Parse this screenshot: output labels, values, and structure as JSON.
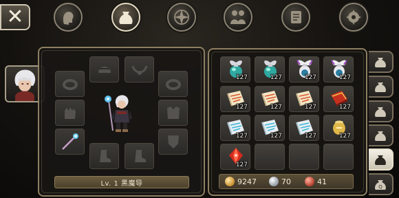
{
  "top_bar": {
    "close_label": "✕",
    "tabs": [
      {
        "name": "character",
        "icon": "head-silhouette-icon"
      },
      {
        "name": "inventory",
        "icon": "bag-icon",
        "active": true
      },
      {
        "name": "skills",
        "icon": "compass-star-icon"
      },
      {
        "name": "party",
        "icon": "two-people-icon"
      },
      {
        "name": "quests",
        "icon": "scroll-icon"
      },
      {
        "name": "settings",
        "icon": "gear-icon"
      }
    ]
  },
  "equipment": {
    "level_label": "Lv. 1 黑魔导",
    "slots": [
      "helmet-slot",
      "necklace-slot",
      "ring-left-slot",
      "ring-right-slot",
      "gloves-slot",
      "armor-slot",
      "weapon-slot",
      "shield-slot",
      "boots-left-slot",
      "boots-right-slot"
    ],
    "equipped_weapon": "staff-icon"
  },
  "inventory": {
    "items": [
      {
        "icon": "blue-potion-icon",
        "count": "127"
      },
      {
        "icon": "blue-potion-icon",
        "count": "127"
      },
      {
        "icon": "white-potion-icon",
        "count": "127"
      },
      {
        "icon": "white-potion-icon",
        "count": "127"
      },
      {
        "icon": "red-scroll-icon",
        "count": "127"
      },
      {
        "icon": "red-scroll-icon",
        "count": "127"
      },
      {
        "icon": "red-scroll-icon",
        "count": "127"
      },
      {
        "icon": "spellbook-icon",
        "count": "127"
      },
      {
        "icon": "blue-scroll-icon",
        "count": "127"
      },
      {
        "icon": "blue-scroll-icon",
        "count": "127"
      },
      {
        "icon": "blue-scroll-icon",
        "count": "127"
      },
      {
        "icon": "gold-urn-icon",
        "count": "127"
      },
      {
        "icon": "red-gem-icon",
        "count": "127"
      },
      {
        "icon": "",
        "count": ""
      },
      {
        "icon": "",
        "count": ""
      },
      {
        "icon": "",
        "count": ""
      }
    ],
    "currency": {
      "gold": "9247",
      "silver": "70",
      "red": "41"
    }
  },
  "bag_tabs": [
    {
      "name": "bag-1",
      "active": false
    },
    {
      "name": "bag-2",
      "active": false
    },
    {
      "name": "bag-3",
      "active": false
    },
    {
      "name": "bag-4",
      "active": false
    },
    {
      "name": "bag-5",
      "active": true
    },
    {
      "name": "quest-bag",
      "active": false
    }
  ],
  "colors": {
    "panel_border": "#8d7f62",
    "gold": "#d9a544",
    "silver": "#b9c0c8",
    "red_coin": "#c0503e"
  }
}
